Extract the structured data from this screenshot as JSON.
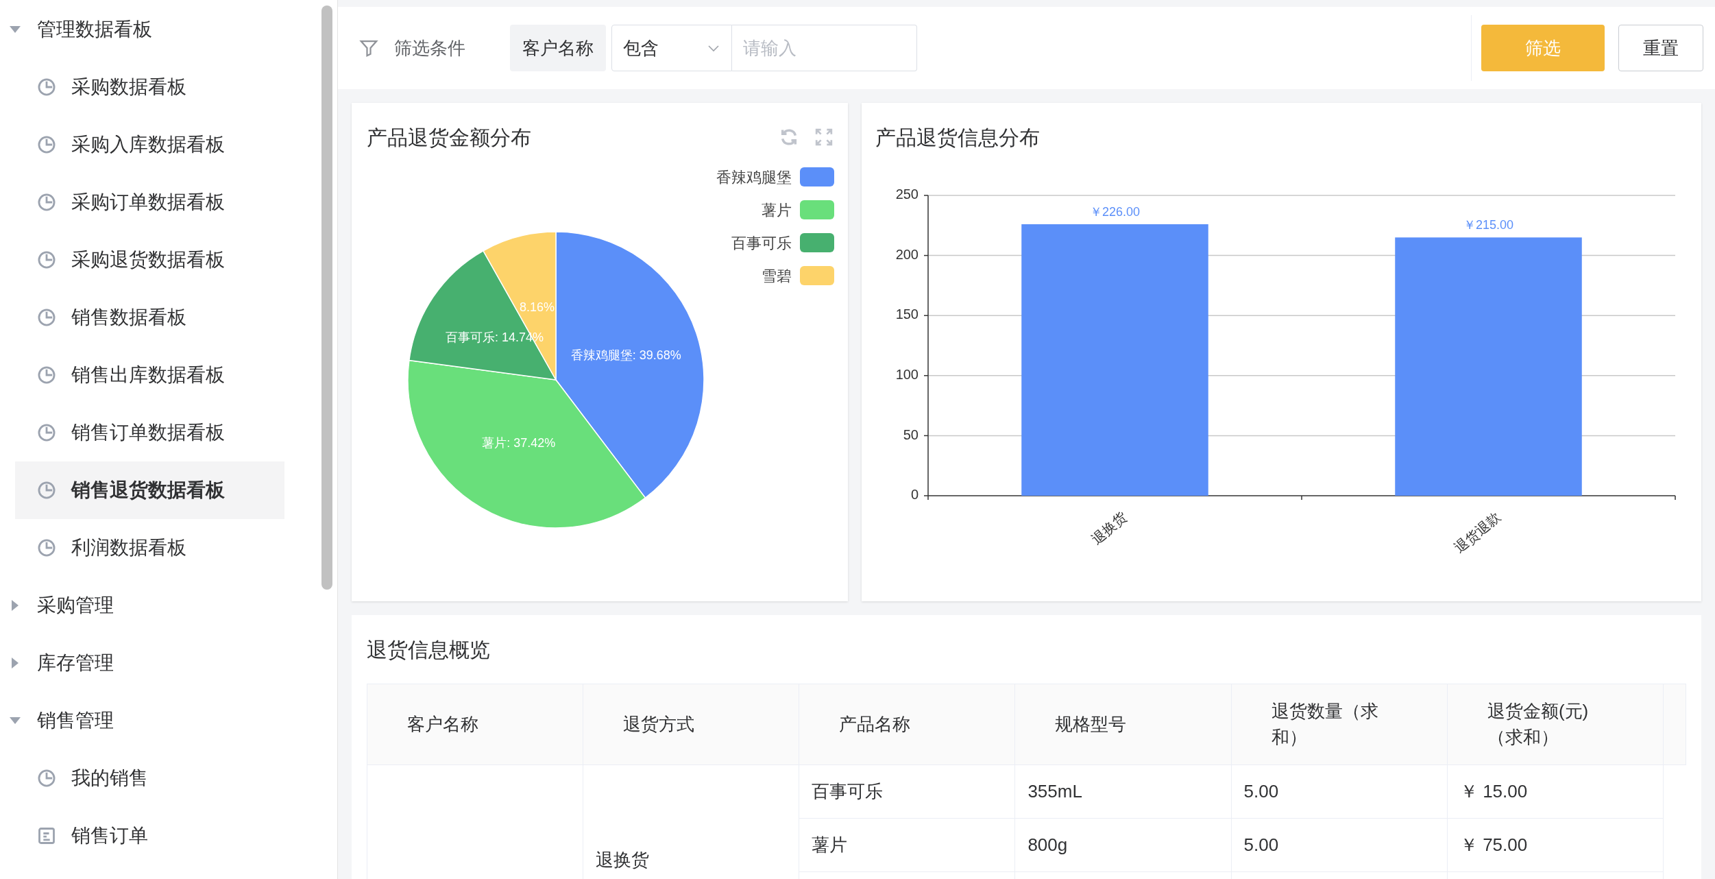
{
  "sidebar": {
    "items": [
      {
        "label": "管理数据看板",
        "expanded": true,
        "children": [
          {
            "label": "采购数据看板",
            "kind": "chart",
            "selected": false
          },
          {
            "label": "采购入库数据看板",
            "kind": "chart",
            "selected": false
          },
          {
            "label": "采购订单数据看板",
            "kind": "chart",
            "selected": false
          },
          {
            "label": "采购退货数据看板",
            "kind": "chart",
            "selected": false
          },
          {
            "label": "销售数据看板",
            "kind": "chart",
            "selected": false
          },
          {
            "label": "销售出库数据看板",
            "kind": "chart",
            "selected": false
          },
          {
            "label": "销售订单数据看板",
            "kind": "chart",
            "selected": false
          },
          {
            "label": "销售退货数据看板",
            "kind": "chart",
            "selected": true
          },
          {
            "label": "利润数据看板",
            "kind": "chart",
            "selected": false
          }
        ]
      },
      {
        "label": "采购管理",
        "expanded": false
      },
      {
        "label": "库存管理",
        "expanded": false
      },
      {
        "label": "销售管理",
        "expanded": true,
        "children": [
          {
            "label": "我的销售",
            "kind": "chart",
            "selected": false
          },
          {
            "label": "销售订单",
            "kind": "document",
            "selected": false
          }
        ]
      }
    ]
  },
  "filter": {
    "label": "筛选条件",
    "field": "客户名称",
    "operator": "包含",
    "placeholder": "请输入",
    "buttons": [
      {
        "label": "筛选",
        "kind": "primary"
      },
      {
        "label": "重置",
        "kind": "default"
      }
    ]
  },
  "pie_card": {
    "title": "产品退货金额分布",
    "chart_data": {
      "type": "pie",
      "categories": [
        "香辣鸡腿堡",
        "薯片",
        "百事可乐",
        "雪碧"
      ],
      "colors": [
        "#5b8ff9",
        "#69df7b",
        "#47b06f",
        "#fdd36a"
      ],
      "values": [
        39.68,
        37.42,
        14.74,
        8.16
      ],
      "legend": true,
      "value_labels": [
        "香辣鸡腿堡: 39.68%",
        "薯片: 37.42%",
        "百事可乐: 14.74%",
        "8.16%"
      ]
    }
  },
  "bar_card": {
    "title": "产品退货信息分布",
    "chart_data": {
      "type": "bar",
      "categories": [
        "退换货",
        "退货退款"
      ],
      "series": [
        {
          "color": "#5b8ff9",
          "values": [
            226,
            215
          ]
        }
      ],
      "grid": true,
      "ylim": [
        0,
        250
      ],
      "yticks": [
        0,
        50,
        100,
        150,
        200,
        250
      ],
      "value_labels": [
        "￥226.00",
        "￥215.00"
      ]
    }
  },
  "table": {
    "title": "退货信息概览",
    "columns": [
      "客户名称",
      "退货方式",
      "产品名称",
      "规格型号",
      "退货数量（求和）",
      "退货金额(元)（求和）"
    ],
    "groups": [
      {
        "method": "退换货",
        "rows": [
          {
            "product": "百事可乐",
            "spec": "355mL",
            "qty": "5.00",
            "amount": "￥ 15.00"
          },
          {
            "product": "薯片",
            "spec": "800g",
            "qty": "5.00",
            "amount": "￥ 75.00"
          }
        ]
      }
    ]
  }
}
